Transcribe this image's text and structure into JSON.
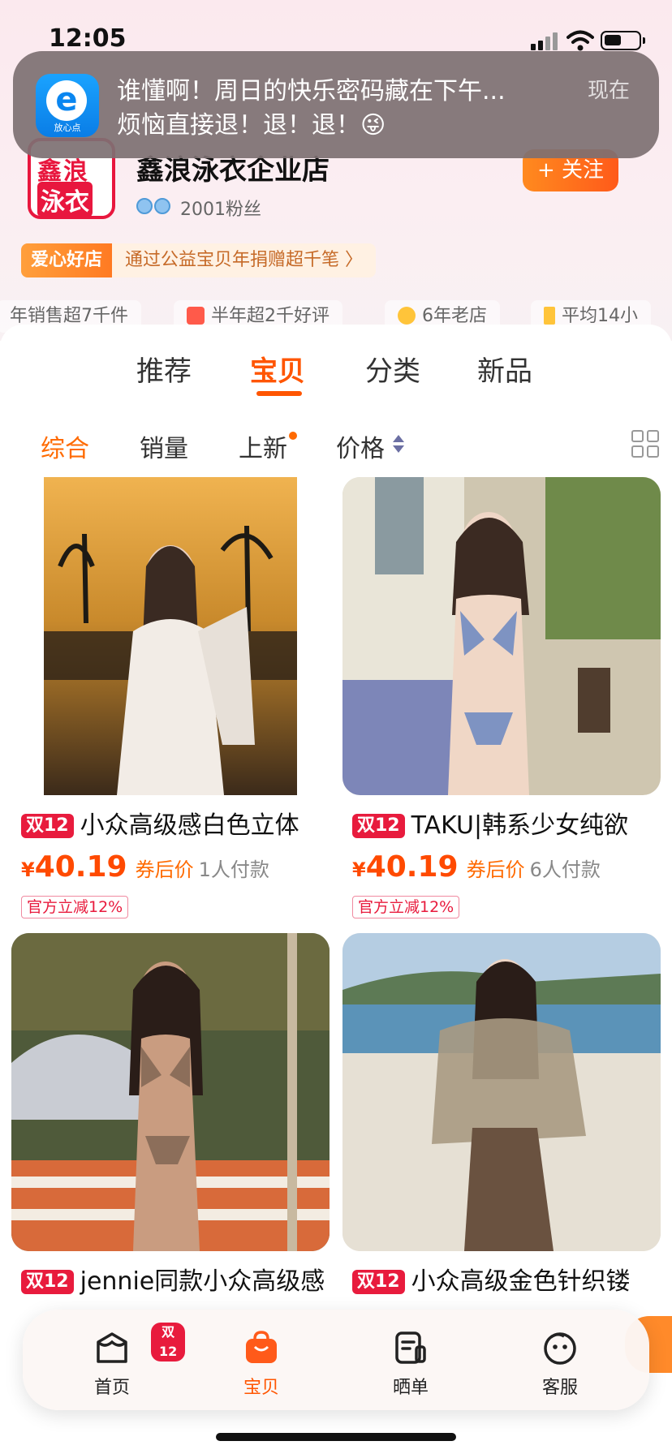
{
  "status_bar": {
    "time": "12:05"
  },
  "notification": {
    "app_icon_label": "放心点",
    "title": "谁懂啊！周日的快乐密码藏在下午...",
    "body": "烦恼直接退！退！退！😜",
    "time": "现在"
  },
  "store": {
    "logo_line1": "鑫浪",
    "logo_line2": "泳衣",
    "name": "鑫浪泳衣企业店",
    "fans": "2001粉丝",
    "follow_label": "+ 关注",
    "badge_tag": "爱心好店",
    "badge_text": "通过公益宝贝年捐赠超千笔 〉",
    "stats": [
      "年销售超7千件",
      "半年超2千好评",
      "6年老店",
      "平均14小"
    ]
  },
  "tabs": [
    "推荐",
    "宝贝",
    "分类",
    "新品"
  ],
  "active_tab": "宝贝",
  "sorts": [
    "综合",
    "销量",
    "上新",
    "价格"
  ],
  "active_sort": "综合",
  "products": [
    {
      "tag": "双12",
      "name": "小众高级感白色立体",
      "currency": "¥",
      "price": "40.19",
      "price_label": "券后价",
      "payments": "1人付款",
      "discount": "官方立减12%"
    },
    {
      "tag": "双12",
      "name": "TAKU|韩系少女纯欲",
      "currency": "¥",
      "price": "40.19",
      "price_label": "券后价",
      "payments": "6人付款",
      "discount": "官方立减12%"
    },
    {
      "tag": "双12",
      "name": "jennie同款小众高级感"
    },
    {
      "tag": "双12",
      "name": "小众高级金色针织镂"
    }
  ],
  "bottom_nav": {
    "items": [
      "首页",
      "宝贝",
      "晒单",
      "客服"
    ],
    "active": "宝贝",
    "home_badge": "双12"
  },
  "colors": {
    "accent": "#ff5500",
    "promo_red": "#e81b3d"
  }
}
